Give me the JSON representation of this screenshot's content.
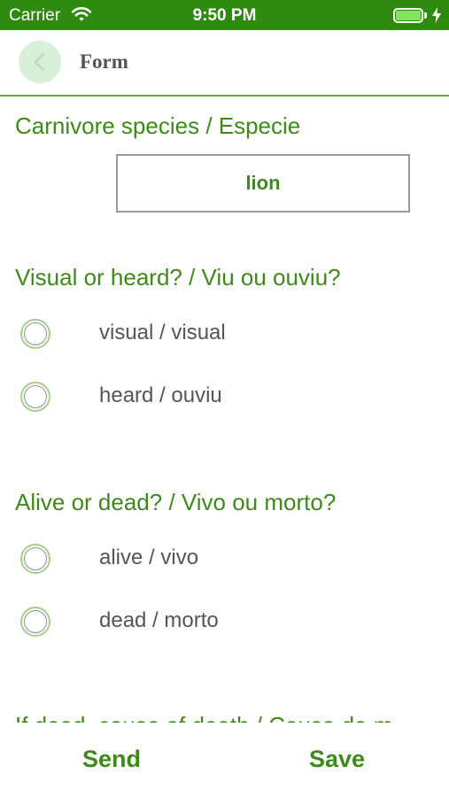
{
  "status_bar": {
    "carrier": "Carrier",
    "time": "9:50 PM"
  },
  "nav": {
    "title": "Form"
  },
  "form": {
    "species": {
      "label": "Carnivore species / Especie",
      "value": "lion"
    },
    "visual_heard": {
      "label": "Visual or heard? / Viu ou ouviu?",
      "options": [
        "visual / visual",
        "heard / ouviu"
      ]
    },
    "alive_dead": {
      "label": "Alive or dead? / Vivo ou morto?",
      "options": [
        "alive / vivo",
        "dead / morto"
      ]
    },
    "cause_of_death": {
      "label": "If dead, cause of death / Causa da m"
    }
  },
  "toolbar": {
    "send_label": "Send",
    "save_label": "Save"
  },
  "colors": {
    "status_bar": "#2f8a10",
    "accent_green": "#3e8a18",
    "radio_ring": "#a6cf8c"
  }
}
